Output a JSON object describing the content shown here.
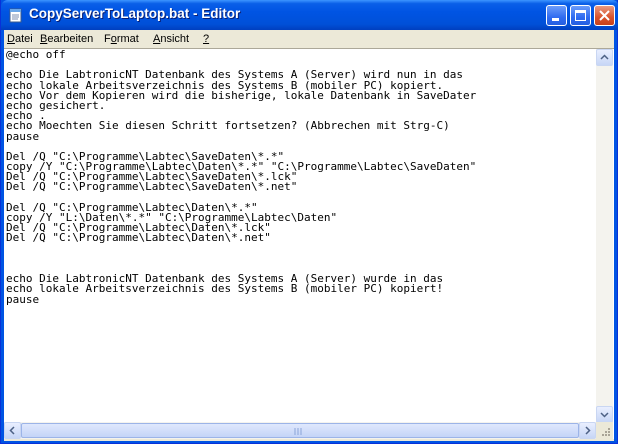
{
  "window": {
    "title": "CopyServerToLaptop.bat - Editor",
    "controls": [
      "minimize",
      "maximize",
      "close"
    ]
  },
  "menu": {
    "items": [
      {
        "label": "Datei",
        "accel": "D",
        "rest": "atei"
      },
      {
        "label": "Bearbeiten",
        "accel": "B",
        "rest": "earbeiten"
      },
      {
        "label": "Format",
        "pre": "F",
        "accel": "o",
        "rest": "rmat"
      },
      {
        "label": "Ansicht",
        "accel": "A",
        "rest": "nsicht"
      },
      {
        "label": "?",
        "accel": "?",
        "rest": ""
      }
    ]
  },
  "document": {
    "lines": [
      "@echo off",
      "",
      "echo Die LabtronicNT Datenbank des Systems A (Server) wird nun in das",
      "echo lokale Arbeitsverzeichnis des Systems B (mobiler PC) kopiert.",
      "echo Vor dem Kopieren wird die bisherige, lokale Datenbank in SaveDater",
      "echo gesichert.",
      "echo .",
      "echo Moechten Sie diesen Schritt fortsetzen? (Abbrechen mit Strg-C)",
      "pause",
      "",
      "Del /Q \"C:\\Programme\\Labtec\\SaveDaten\\*.*\"",
      "copy /Y \"C:\\Programme\\Labtec\\Daten\\*.*\" \"C:\\Programme\\Labtec\\SaveDaten\"",
      "Del /Q \"C:\\Programme\\Labtec\\SaveDaten\\*.lck\"",
      "Del /Q \"C:\\Programme\\Labtec\\SaveDaten\\*.net\"",
      "",
      "Del /Q \"C:\\Programme\\Labtec\\Daten\\*.*\"",
      "copy /Y \"L:\\Daten\\*.*\" \"C:\\Programme\\Labtec\\Daten\"",
      "Del /Q \"C:\\Programme\\Labtec\\Daten\\*.lck\"",
      "Del /Q \"C:\\Programme\\Labtec\\Daten\\*.net\"",
      "",
      "",
      "",
      "echo Die LabtronicNT Datenbank des Systems A (Server) wurde in das",
      "echo lokale Arbeitsverzeichnis des Systems B (mobiler PC) kopiert!",
      "pause"
    ]
  },
  "colors": {
    "titlebar": "#0054e3",
    "close_button": "#d9532c",
    "editor_background": "#ffffff"
  }
}
